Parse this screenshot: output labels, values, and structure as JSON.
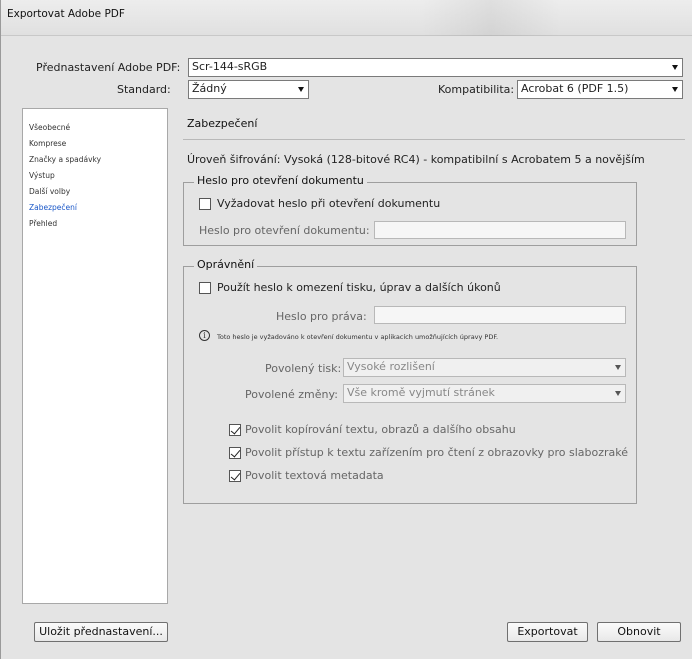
{
  "window": {
    "title": "Exportovat Adobe PDF"
  },
  "preset": {
    "label": "Přednastavení Adobe PDF:",
    "value": "Scr-144-sRGB"
  },
  "standard": {
    "label": "Standard:",
    "value": "Žádný"
  },
  "compatibility": {
    "label": "Kompatibilita:",
    "value": "Acrobat 6 (PDF 1.5)"
  },
  "sidebar": {
    "items": [
      {
        "label": "Všeobecné",
        "selected": false
      },
      {
        "label": "Komprese",
        "selected": false
      },
      {
        "label": "Značky a spadávky",
        "selected": false
      },
      {
        "label": "Výstup",
        "selected": false
      },
      {
        "label": "Další volby",
        "selected": false
      },
      {
        "label": "Zabezpečení",
        "selected": true
      },
      {
        "label": "Přehled",
        "selected": false
      }
    ]
  },
  "panel": {
    "title": "Zabezpečení",
    "encryption": "Úroveň šifrování: Vysoká (128-bitové RC4) - kompatibilní s Acrobatem 5 a novějším",
    "open_password_group": {
      "legend": "Heslo pro otevření dokumentu",
      "require_checkbox": {
        "label": "Vyžadovat heslo při otevření dokumentu",
        "checked": false
      },
      "password_field": {
        "label": "Heslo pro otevření dokumentu:",
        "value": ""
      }
    },
    "permissions_group": {
      "legend": "Oprávnění",
      "use_password_checkbox": {
        "label": "Použít heslo k omezení tisku, úprav a dalších úkonů",
        "checked": false
      },
      "permissions_password": {
        "label": "Heslo pro práva:",
        "value": ""
      },
      "info_note": "Toto heslo je vyžadováno k otevření dokumentu v aplikacích umožňujících úpravy PDF.",
      "printing": {
        "label": "Povolený tisk:",
        "value": "Vysoké rozlišení"
      },
      "changes": {
        "label": "Povolené změny:",
        "value": "Vše kromě vyjmutí stránek"
      },
      "checkboxes": [
        {
          "label": "Povolit kopírování textu, obrazů a dalšího obsahu",
          "checked": true
        },
        {
          "label": "Povolit přístup k textu zařízením pro čtení z obrazovky pro slabozraké",
          "checked": true
        },
        {
          "label": "Povolit textová metadata",
          "checked": true
        }
      ]
    }
  },
  "buttons": {
    "save_preset": "Uložit přednastavení...",
    "export": "Exportovat",
    "reset": "Obnovit"
  }
}
